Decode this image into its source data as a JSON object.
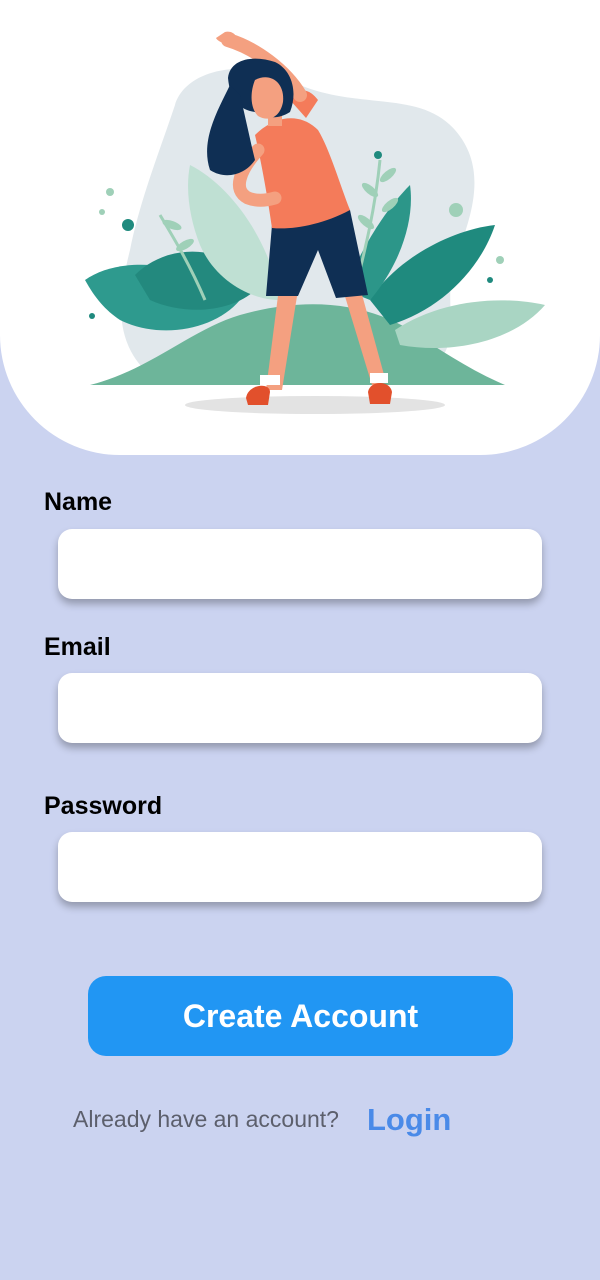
{
  "form": {
    "name_label": "Name",
    "name_value": "",
    "email_label": "Email",
    "email_value": "",
    "password_label": "Password",
    "password_value": ""
  },
  "actions": {
    "create_account_label": "Create Account"
  },
  "footer": {
    "prompt_text": "Already have an account?",
    "login_link_label": "Login"
  },
  "colors": {
    "background": "#cbd3f0",
    "primary_button": "#2196f3",
    "link": "#4a8ae8"
  },
  "icons": {
    "hero": "woman-stretching-illustration"
  }
}
